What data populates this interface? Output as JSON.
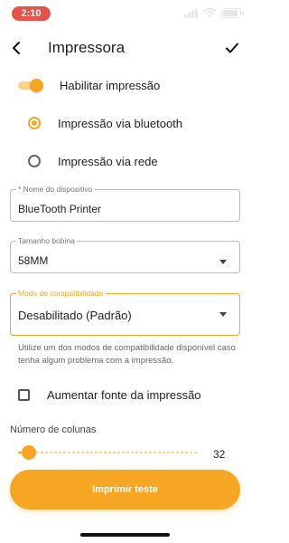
{
  "status_bar": {
    "time": "2:10"
  },
  "app_bar": {
    "title": "Impressora"
  },
  "enable_print": {
    "label": "Habilitar impressão",
    "on": true
  },
  "print_mode": {
    "options": [
      {
        "label": "Impressão via bluetooth",
        "selected": true
      },
      {
        "label": "Impressão via rede",
        "selected": false
      }
    ]
  },
  "device_name": {
    "label": "* Nome do dispositivo",
    "value": "BlueTooth Printer"
  },
  "paper_size": {
    "label": "Tamanho bobina",
    "value": "58MM"
  },
  "compat_mode": {
    "label": "Modo de compatibilidade",
    "value": "Desabilitado (Padrão)",
    "helper": "Utilize um dos modos de compatibilidade disponível caso tenha algum problema com a impressão."
  },
  "large_font": {
    "label": "Aumentar fonte da impressão",
    "checked": false
  },
  "columns": {
    "label": "Número de colunas",
    "value": "32",
    "slider_fraction": 0.05
  },
  "print_test_button": {
    "label": "Imprimir teste"
  },
  "colors": {
    "accent": "#f6a623",
    "status_pill": "#e5534b"
  }
}
